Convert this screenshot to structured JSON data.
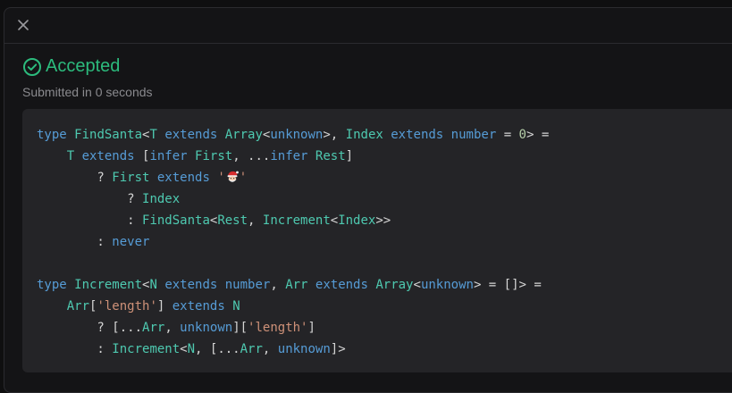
{
  "header": {
    "close_icon": "close-icon"
  },
  "result": {
    "status": "Accepted",
    "status_color": "#2cbb7d",
    "status_icon": "check-circle-icon",
    "subtitle": "Submitted in 0 seconds"
  },
  "code": {
    "language": "typescript",
    "colors": {
      "keyword": "#569cd6",
      "type": "#4ec9b0",
      "string": "#ce9178",
      "number": "#b5cea8",
      "plain": "#d4d4d4"
    },
    "lines": [
      [
        [
          "kw",
          "type "
        ],
        [
          "ty",
          "FindSanta"
        ],
        [
          "pl",
          "<"
        ],
        [
          "ty",
          "T "
        ],
        [
          "kw",
          "extends "
        ],
        [
          "ty",
          "Array"
        ],
        [
          "pl",
          "<"
        ],
        [
          "kw",
          "unknown"
        ],
        [
          "pl",
          ">, "
        ],
        [
          "ty",
          "Index "
        ],
        [
          "kw",
          "extends "
        ],
        [
          "kw",
          "number "
        ],
        [
          "pl",
          "= "
        ],
        [
          "num",
          "0"
        ],
        [
          "pl",
          "> ="
        ]
      ],
      [
        [
          "pl",
          "    "
        ],
        [
          "ty",
          "T "
        ],
        [
          "kw",
          "extends "
        ],
        [
          "pl",
          "["
        ],
        [
          "kw",
          "infer "
        ],
        [
          "ty",
          "First"
        ],
        [
          "pl",
          ", ..."
        ],
        [
          "kw",
          "infer "
        ],
        [
          "ty",
          "Rest"
        ],
        [
          "pl",
          "]"
        ]
      ],
      [
        [
          "pl",
          "        ? "
        ],
        [
          "ty",
          "First "
        ],
        [
          "kw",
          "extends "
        ],
        [
          "str",
          "'"
        ],
        [
          "emoji",
          "santa-emoji-icon"
        ],
        [
          "str",
          "'"
        ]
      ],
      [
        [
          "pl",
          "            ? "
        ],
        [
          "ty",
          "Index"
        ]
      ],
      [
        [
          "pl",
          "            : "
        ],
        [
          "ty",
          "FindSanta"
        ],
        [
          "pl",
          "<"
        ],
        [
          "ty",
          "Rest"
        ],
        [
          "pl",
          ", "
        ],
        [
          "ty",
          "Increment"
        ],
        [
          "pl",
          "<"
        ],
        [
          "ty",
          "Index"
        ],
        [
          "pl",
          ">>"
        ]
      ],
      [
        [
          "pl",
          "        : "
        ],
        [
          "kw",
          "never"
        ]
      ],
      [],
      [
        [
          "kw",
          "type "
        ],
        [
          "ty",
          "Increment"
        ],
        [
          "pl",
          "<"
        ],
        [
          "ty",
          "N "
        ],
        [
          "kw",
          "extends "
        ],
        [
          "kw",
          "number"
        ],
        [
          "pl",
          ", "
        ],
        [
          "ty",
          "Arr "
        ],
        [
          "kw",
          "extends "
        ],
        [
          "ty",
          "Array"
        ],
        [
          "pl",
          "<"
        ],
        [
          "kw",
          "unknown"
        ],
        [
          "pl",
          "> = []> ="
        ]
      ],
      [
        [
          "pl",
          "    "
        ],
        [
          "ty",
          "Arr"
        ],
        [
          "pl",
          "["
        ],
        [
          "str",
          "'length'"
        ],
        [
          "pl",
          "] "
        ],
        [
          "kw",
          "extends "
        ],
        [
          "ty",
          "N"
        ]
      ],
      [
        [
          "pl",
          "        ? [..."
        ],
        [
          "ty",
          "Arr"
        ],
        [
          "pl",
          ", "
        ],
        [
          "kw",
          "unknown"
        ],
        [
          "pl",
          "]["
        ],
        [
          "str",
          "'length'"
        ],
        [
          "pl",
          "]"
        ]
      ],
      [
        [
          "pl",
          "        : "
        ],
        [
          "ty",
          "Increment"
        ],
        [
          "pl",
          "<"
        ],
        [
          "ty",
          "N"
        ],
        [
          "pl",
          ", [..."
        ],
        [
          "ty",
          "Arr"
        ],
        [
          "pl",
          ", "
        ],
        [
          "kw",
          "unknown"
        ],
        [
          "pl",
          "]>"
        ]
      ]
    ]
  }
}
